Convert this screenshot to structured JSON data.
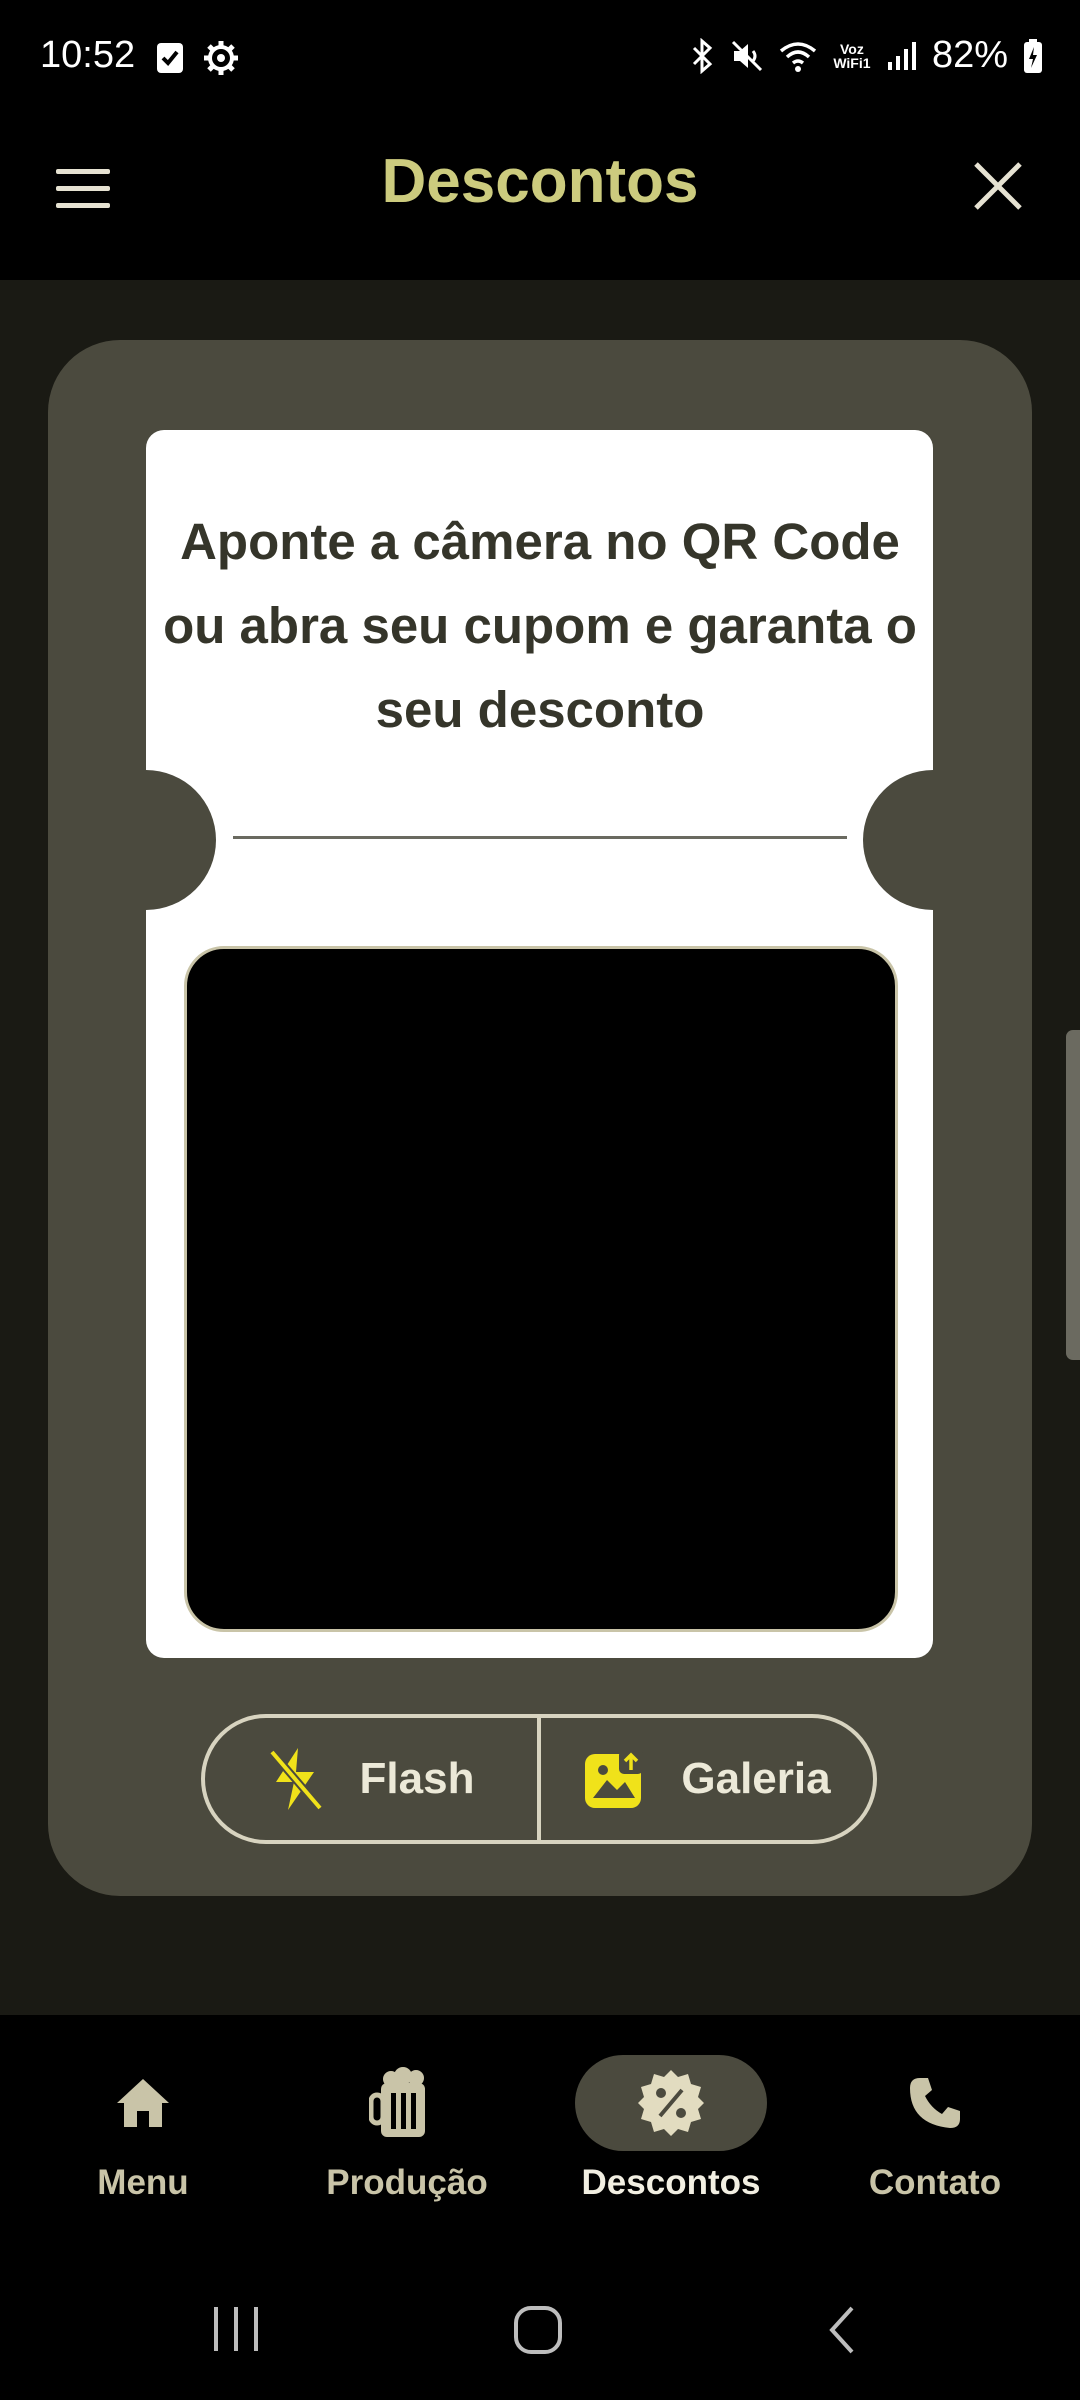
{
  "status_bar": {
    "time": "10:52",
    "network_label": "Voz\nWiFi1",
    "battery": "82%"
  },
  "app_bar": {
    "title": "Descontos"
  },
  "scanner": {
    "instructions": "Aponte a câmera no QR Code ou abra seu cupom e garanta o seu desconto",
    "flash_label": "Flash",
    "gallery_label": "Galeria"
  },
  "bottom_nav": {
    "items": [
      {
        "label": "Menu",
        "icon": "home-icon"
      },
      {
        "label": "Produção",
        "icon": "beer-mug-icon"
      },
      {
        "label": "Descontos",
        "icon": "discount-badge-icon",
        "active": true
      },
      {
        "label": "Contato",
        "icon": "phone-icon"
      }
    ]
  },
  "colors": {
    "accent_title": "#cccb7e",
    "panel": "#4b4a3e",
    "icon_yellow": "#f0e21a",
    "active_nav_bg": "#4b4a3e"
  }
}
